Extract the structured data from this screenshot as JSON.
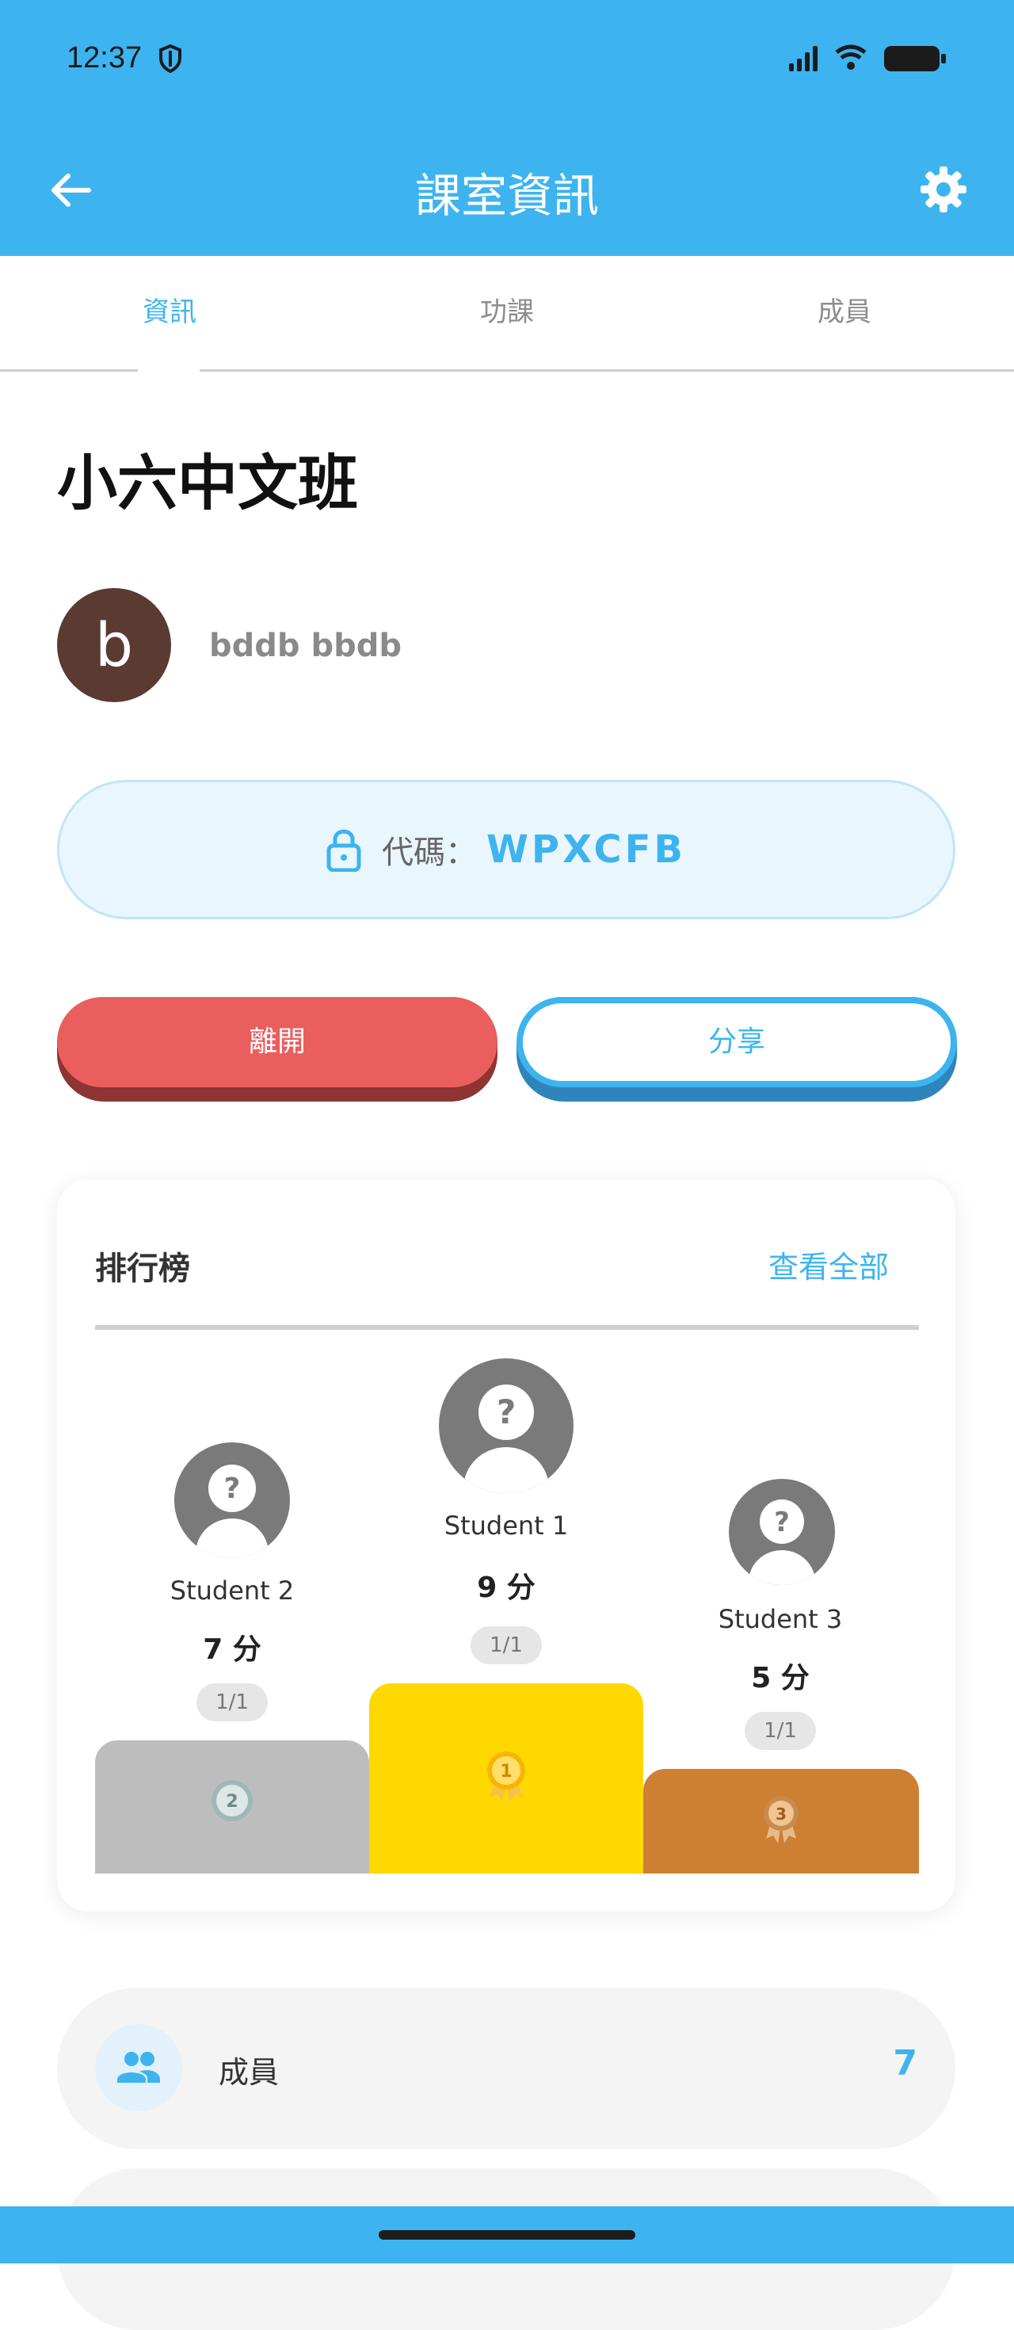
{
  "status_bar": {
    "time": "12:37"
  },
  "header": {
    "title": "課室資訊"
  },
  "tabs": [
    {
      "label": "資訊",
      "active": true
    },
    {
      "label": "功課",
      "active": false
    },
    {
      "label": "成員",
      "active": false
    }
  ],
  "classroom": {
    "name": "小六中文班",
    "owner_initial": "b",
    "owner_name": "bddb bbdb",
    "code_label": "代碼：",
    "code_value": "WPXCFB"
  },
  "actions": {
    "leave_label": "離開",
    "share_label": "分享"
  },
  "leaderboard": {
    "title": "排行榜",
    "view_all": "查看全部",
    "entries": [
      {
        "rank": 2,
        "name": "Student 2",
        "score": "7 分",
        "progress": "1/1",
        "rank_label": "2"
      },
      {
        "rank": 1,
        "name": "Student 1",
        "score": "9 分",
        "progress": "1/1",
        "rank_label": "1"
      },
      {
        "rank": 3,
        "name": "Student 3",
        "score": "5 分",
        "progress": "1/1",
        "rank_label": "3"
      }
    ]
  },
  "members": {
    "label": "成員",
    "count": "7"
  },
  "colors": {
    "accent": "#3DB4EF",
    "leave": "#EA5E5E",
    "gold": "#FFD800",
    "silver": "#BDBDBD",
    "bronze": "#CD7F32"
  }
}
